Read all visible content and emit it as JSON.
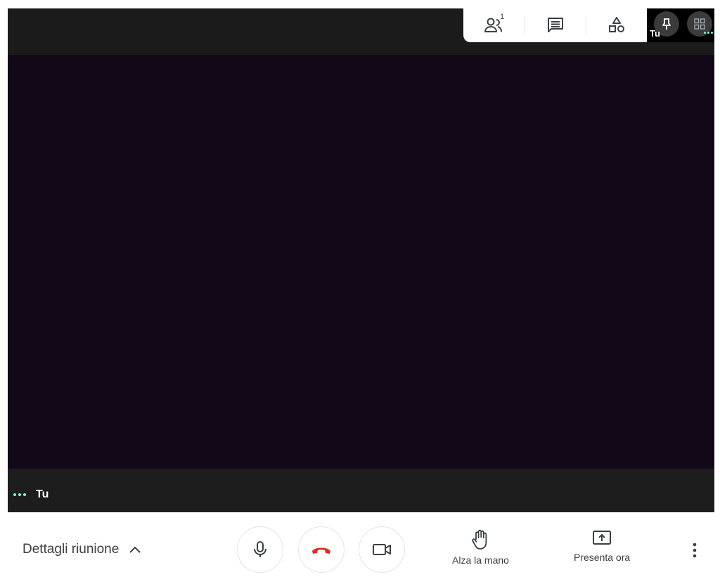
{
  "toolbar": {
    "participants_count": "1"
  },
  "self_tile": {
    "name": "Tu"
  },
  "stage": {
    "self_label": "Tu"
  },
  "footer": {
    "details_label": "Dettagli riunione",
    "raise_hand_label": "Alza la mano",
    "present_label": "Presenta ora"
  },
  "colors": {
    "video_bg": "#120818",
    "hangup_red": "#d93025",
    "active_dots": "#7ff0dc"
  },
  "icons": [
    "people-icon",
    "chat-icon",
    "activities-icon",
    "pin-icon",
    "grid-icon",
    "mic-icon",
    "hang-up-icon",
    "camera-icon",
    "raise-hand-icon",
    "present-icon",
    "more-vert-icon",
    "chevron-up-icon"
  ]
}
